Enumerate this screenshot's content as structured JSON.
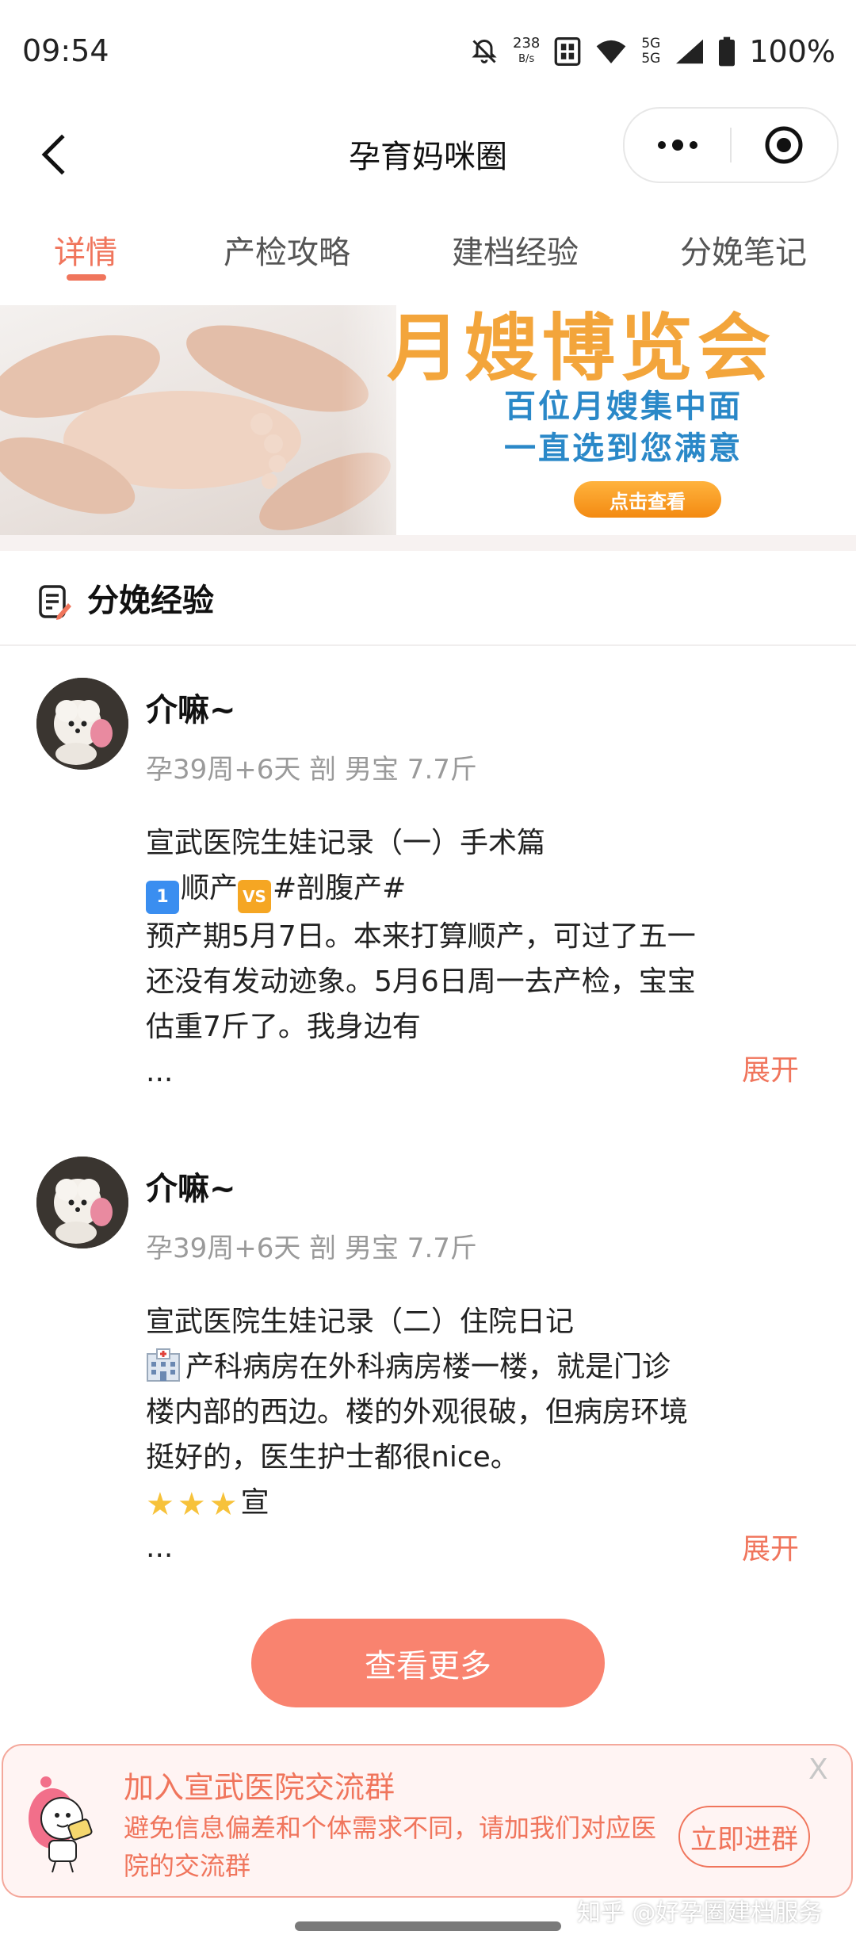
{
  "status_bar": {
    "time": "09:54",
    "net_speed_value": "238",
    "net_speed_unit": "B/s",
    "network_5g_top": "5G",
    "network_5g_bottom": "5G",
    "battery": "100%"
  },
  "nav": {
    "title": "孕育妈咪圈",
    "back_icon": "chevron-left-icon",
    "more_icon": "more-dots-icon",
    "close_icon": "target-icon"
  },
  "tabs": [
    {
      "label": "详情",
      "active": true
    },
    {
      "label": "产检攻略",
      "active": false
    },
    {
      "label": "建档经验",
      "active": false
    },
    {
      "label": "分娩笔记",
      "active": false
    }
  ],
  "banner": {
    "title": "月嫂博览会",
    "line1": "百位月嫂集中面",
    "line2": "一直选到您满意",
    "cta": "点击查看"
  },
  "section": {
    "title": "分娩经验"
  },
  "posts": [
    {
      "author": "介嘛~",
      "meta": "孕39周+6天 剖 男宝 7.7斤",
      "line1": "宣武医院生娃记录（一）手术篇",
      "line2_badge": "1",
      "line2_a": "顺产",
      "line2_vs": "VS",
      "line2_b": "#剖腹产#",
      "line3": "预产期5月7日。本来打算顺产，可过了五一",
      "line4": "还没有发动迹象。5月6日周一去产检，宝宝",
      "line5": "估重7斤了。我身边有",
      "ellipsis": "...",
      "expand": "展开"
    },
    {
      "author": "介嘛~",
      "meta": "孕39周+6天 剖 男宝 7.7斤",
      "line1": "宣武医院生娃记录（二）住院日记",
      "line2": "产科病房在外科病房楼一楼，就是门诊",
      "line3": "楼内部的西边。楼的外观很破，但病房环境",
      "line4": "挺好的，医生护士都很nice。",
      "line5": "宣",
      "ellipsis": "...",
      "expand": "展开"
    }
  ],
  "more_button": "查看更多",
  "promo": {
    "title": "加入宣武医院交流群",
    "desc": "避免信息偏差和个体需求不同，请加我们对应医院的交流群",
    "close": "X",
    "join": "立即进群"
  },
  "credit": "知乎 @好孕圈建档服务",
  "colors": {
    "accent": "#f0755c",
    "button": "#f9836f",
    "banner_orange": "#f3a53b",
    "banner_blue": "#2a88c8"
  }
}
